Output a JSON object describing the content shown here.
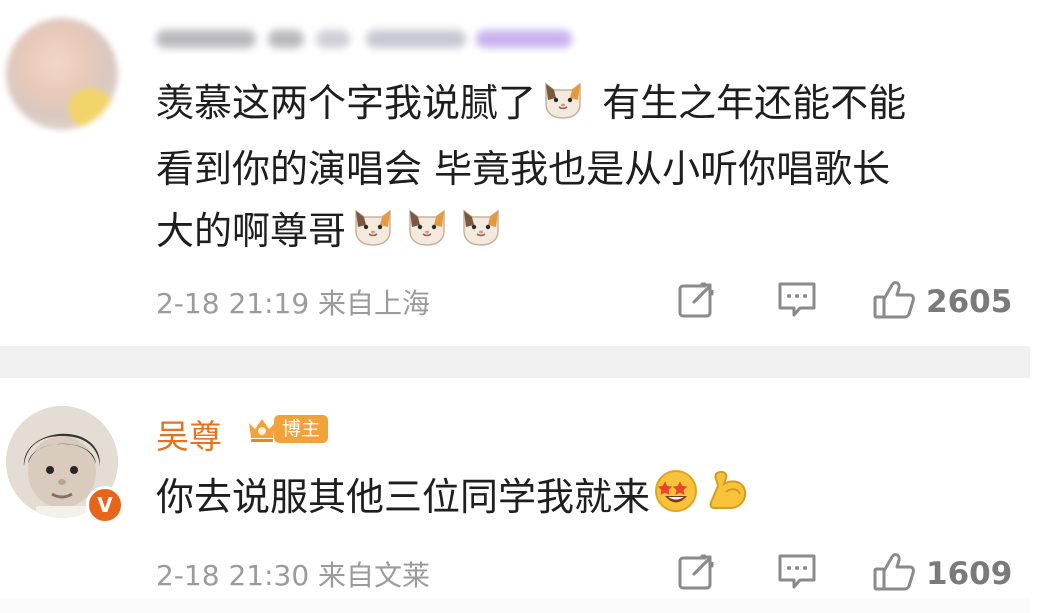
{
  "comments": [
    {
      "username": "",
      "content_segments": [
        "羡慕这两个字我说腻了",
        "有生之年还能不能",
        "看到你的演唱会 毕竟我也是从小听你唱歌长",
        "大的啊尊哥"
      ],
      "emoji": "cat-face-emoji",
      "time": "2-18 21:19",
      "location": "来自上海",
      "likes": "2605",
      "icons": [
        "share-icon",
        "comment-icon",
        "thumbs-up-icon"
      ]
    },
    {
      "username": "吴尊",
      "badge": "博主",
      "verified": "V",
      "content": "你去说服其他三位同学我就来",
      "emojis": [
        "star-struck-emoji",
        "flexed-biceps-emoji"
      ],
      "time": "2-18 21:30",
      "location": "来自文莱",
      "likes": "1609",
      "icons": [
        "share-icon",
        "comment-icon",
        "thumbs-up-icon"
      ]
    }
  ],
  "colors": {
    "username": "#e8721c",
    "badge": "#f2a23a",
    "meta_text": "#9b9b9b",
    "separator": "#f1f1f1",
    "verified": "#e8641b"
  }
}
